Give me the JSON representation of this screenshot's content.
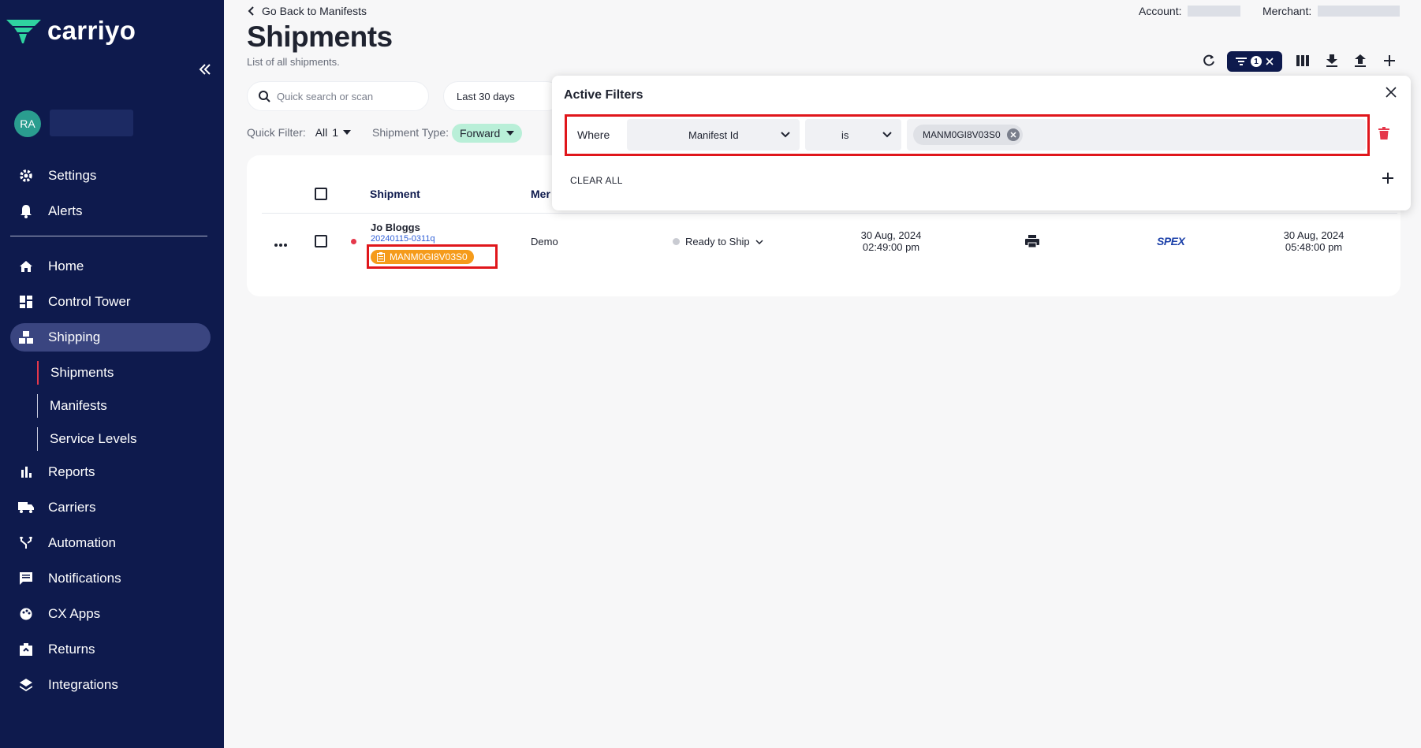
{
  "brand": {
    "name": "carriyo",
    "accent": "#2fd3a0",
    "sidebar_bg": "#0e1a4d"
  },
  "user": {
    "initials": "RA"
  },
  "sidebar": {
    "top_items": [
      {
        "label": "Settings",
        "icon": "gear-icon"
      },
      {
        "label": "Alerts",
        "icon": "bell-icon"
      }
    ],
    "items": [
      {
        "label": "Home",
        "icon": "home-icon"
      },
      {
        "label": "Control Tower",
        "icon": "dashboard-icon"
      },
      {
        "label": "Shipping",
        "icon": "boxes-icon",
        "active": true
      },
      {
        "label": "Reports",
        "icon": "bar-chart-icon"
      },
      {
        "label": "Carriers",
        "icon": "truck-icon"
      },
      {
        "label": "Automation",
        "icon": "fork-icon"
      },
      {
        "label": "Notifications",
        "icon": "message-icon"
      },
      {
        "label": "CX Apps",
        "icon": "palette-icon"
      },
      {
        "label": "Returns",
        "icon": "return-box-icon"
      },
      {
        "label": "Integrations",
        "icon": "layers-icon"
      }
    ],
    "sub_items": [
      {
        "label": "Shipments",
        "active": true
      },
      {
        "label": "Manifests"
      },
      {
        "label": "Service Levels"
      }
    ]
  },
  "header": {
    "back_link": "Go Back to Manifests",
    "title": "Shipments",
    "subtitle": "List of all shipments.",
    "account_label": "Account:",
    "merchant_label": "Merchant:",
    "filter_count": "1"
  },
  "search": {
    "placeholder": "Quick search or scan"
  },
  "date_range": "Last 30 days",
  "quick_filter": {
    "label": "Quick Filter:",
    "value": "All",
    "count": "1"
  },
  "shipment_type": {
    "label": "Shipment Type:",
    "value": "Forward"
  },
  "table": {
    "headers": {
      "shipment": "Shipment",
      "merchant": "Mer"
    },
    "rows": [
      {
        "customer": "Jo Bloggs",
        "order_id": "20240115-0311q",
        "manifest_id": "MANM0GI8V03S0",
        "merchant": "Demo",
        "status": "Ready to Ship",
        "created_date": "30 Aug, 2024",
        "created_time": "02:49:00 pm",
        "carrier": "SPEX",
        "updated_date": "30 Aug, 2024",
        "updated_time": "05:48:00 pm"
      }
    ]
  },
  "filters_popup": {
    "title": "Active Filters",
    "where": "Where",
    "field": "Manifest Id",
    "operator": "is",
    "value": "MANM0GI8V03S0",
    "clear_all": "CLEAR ALL"
  }
}
